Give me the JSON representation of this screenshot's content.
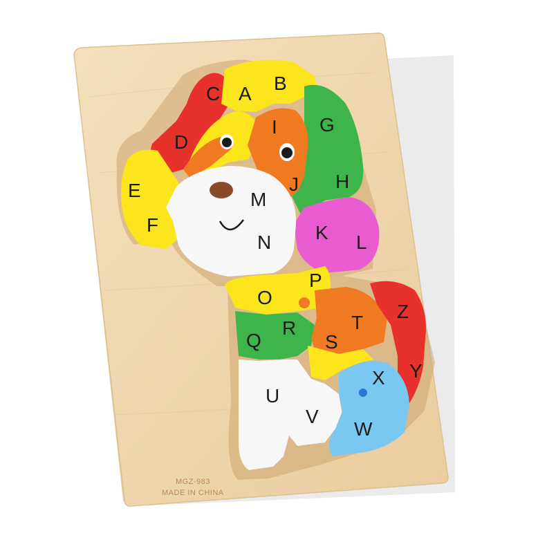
{
  "board": {
    "model": "MGZ-983",
    "origin": "MADE IN CHINA"
  },
  "letters": [
    "A",
    "B",
    "C",
    "D",
    "E",
    "F",
    "G",
    "H",
    "I",
    "J",
    "K",
    "L",
    "M",
    "N",
    "O",
    "P",
    "Q",
    "R",
    "S",
    "T",
    "U",
    "V",
    "W",
    "X",
    "Y",
    "Z"
  ],
  "colors": {
    "wood": "#f1d9b2",
    "red": "#e8312b",
    "yellow": "#fbe51c",
    "green": "#3db54a",
    "orange": "#f07a22",
    "pink": "#e95bd0",
    "white": "#f7f7f7",
    "blue": "#7ac7f2"
  }
}
